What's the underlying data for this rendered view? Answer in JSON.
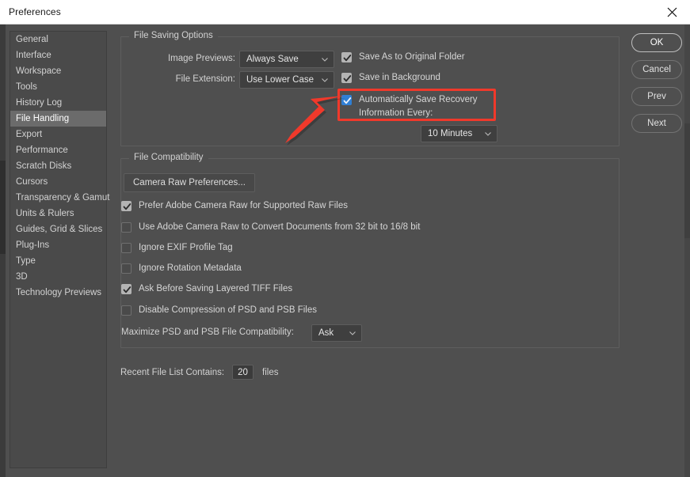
{
  "window": {
    "title": "Preferences",
    "close_icon": "close-x-icon"
  },
  "sidebar": {
    "items": [
      {
        "label": "General",
        "active": false
      },
      {
        "label": "Interface",
        "active": false
      },
      {
        "label": "Workspace",
        "active": false
      },
      {
        "label": "Tools",
        "active": false
      },
      {
        "label": "History Log",
        "active": false
      },
      {
        "label": "File Handling",
        "active": true
      },
      {
        "label": "Export",
        "active": false
      },
      {
        "label": "Performance",
        "active": false
      },
      {
        "label": "Scratch Disks",
        "active": false
      },
      {
        "label": "Cursors",
        "active": false
      },
      {
        "label": "Transparency & Gamut",
        "active": false
      },
      {
        "label": "Units & Rulers",
        "active": false
      },
      {
        "label": "Guides, Grid & Slices",
        "active": false
      },
      {
        "label": "Plug-Ins",
        "active": false
      },
      {
        "label": "Type",
        "active": false
      },
      {
        "label": "3D",
        "active": false
      },
      {
        "label": "Technology Previews",
        "active": false
      }
    ]
  },
  "buttons": {
    "ok": "OK",
    "cancel": "Cancel",
    "prev": "Prev",
    "next": "Next"
  },
  "file_saving": {
    "group_title": "File Saving Options",
    "image_previews_label": "Image Previews:",
    "image_previews_value": "Always Save",
    "file_extension_label": "File Extension:",
    "file_extension_value": "Use Lower Case",
    "save_as_original_label": "Save As to Original Folder",
    "save_as_original_checked": true,
    "save_background_label": "Save in Background",
    "save_background_checked": true,
    "autosave_label_line1": "Automatically Save Recovery",
    "autosave_label_line2": "Information Every:",
    "autosave_checked": true,
    "autosave_interval_value": "10 Minutes"
  },
  "file_compatibility": {
    "group_title": "File Compatibility",
    "camera_raw_button": "Camera Raw Preferences...",
    "options": [
      {
        "label": "Prefer Adobe Camera Raw for Supported Raw Files",
        "checked": true
      },
      {
        "label": "Use Adobe Camera Raw to Convert Documents from 32 bit to 16/8 bit",
        "checked": false
      },
      {
        "label": "Ignore EXIF Profile Tag",
        "checked": false
      },
      {
        "label": "Ignore Rotation Metadata",
        "checked": false
      },
      {
        "label": "Ask Before Saving Layered TIFF Files",
        "checked": true
      },
      {
        "label": "Disable Compression of PSD and PSB Files",
        "checked": false
      }
    ],
    "maximize_label": "Maximize PSD and PSB File Compatibility:",
    "maximize_value": "Ask"
  },
  "recent_files": {
    "label": "Recent File List Contains:",
    "value": "20",
    "suffix": "files"
  },
  "annotation": {
    "highlight_color": "#f0392b",
    "arrow_icon": "pointer-arrow-icon",
    "target": "Automatically Save Recovery Information Every:"
  },
  "colors": {
    "dialog_bg": "#4f4f4f",
    "panel_bg": "#4a4a4a",
    "accent_checkbox": "#2f7fd4",
    "selected_item_bg": "#6b6b6b",
    "titlebar_bg": "#ffffff"
  }
}
